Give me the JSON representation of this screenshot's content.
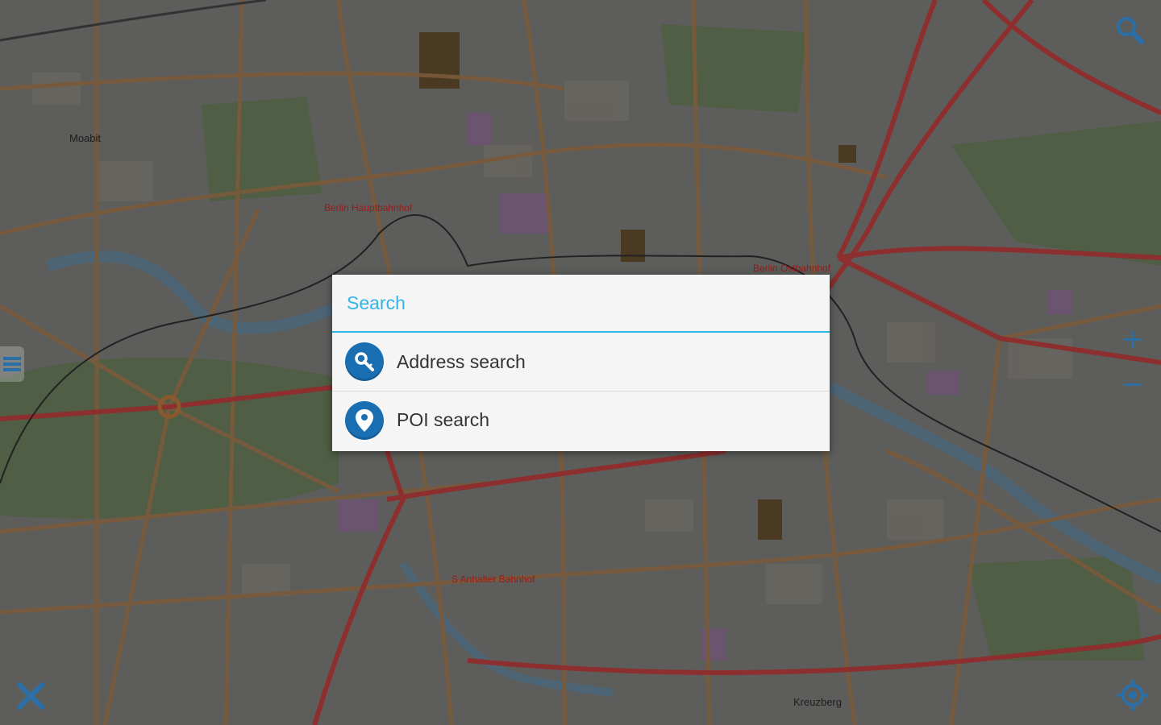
{
  "map": {
    "labels": {
      "moabit": "Moabit",
      "hauptbahnhof": "Berlin Hauptbahnhof",
      "ostbahnhof": "Berlin Ostbahnhof",
      "anhalter": "S Anhalter Bahnhof",
      "kreuzberg": "Kreuzberg"
    }
  },
  "dialog": {
    "title": "Search",
    "items": [
      {
        "label": "Address search",
        "icon": "address-search-icon"
      },
      {
        "label": "POI search",
        "icon": "poi-location-pin-icon"
      }
    ]
  },
  "controls": {
    "zoom_in": "+",
    "zoom_out": "−"
  },
  "colors": {
    "accent": "#33b5e5",
    "icon_blue": "#1a6fb3",
    "map_road": "#8a5a2c",
    "map_main_road": "#9b3030"
  }
}
